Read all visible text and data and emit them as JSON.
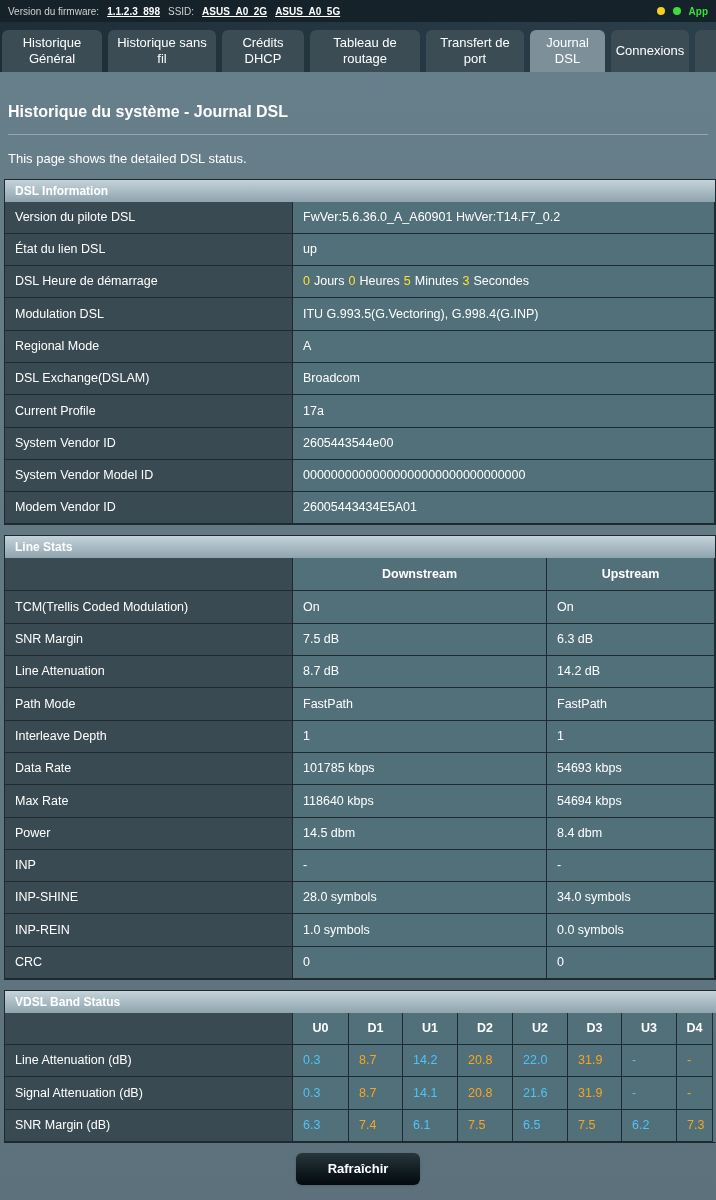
{
  "top_bar": {
    "firmware_label": "Version du firmware:",
    "firmware": "1.1.2.3_898",
    "ssid_label": "SSID:",
    "ssids": [
      "ASUS_A0_2G",
      "ASUS_A0_5G"
    ],
    "app": "App"
  },
  "tabs": [
    {
      "label": "Historique Général",
      "selected": false
    },
    {
      "label": "Historique sans fil",
      "selected": false
    },
    {
      "label": "Crédits DHCP",
      "selected": false
    },
    {
      "label": "Tableau de routage",
      "selected": false
    },
    {
      "label": "Transfert de port",
      "selected": false
    },
    {
      "label": "Journal DSL",
      "selected": true
    },
    {
      "label": "Connexions",
      "selected": false
    }
  ],
  "page_title": "Historique du système - Journal DSL",
  "description": "This page shows the detailed DSL status.",
  "dsl_information": {
    "title": "DSL Information",
    "rows": [
      {
        "label": "Version du pilote DSL",
        "value": "FwVer:5.6.36.0_A_A60901 HwVer:T14.F7_0.2"
      },
      {
        "label": "État du lien DSL",
        "value": "up"
      },
      {
        "label": "DSL Heure de démarrage",
        "parts": [
          {
            "kind": "number",
            "text": "0"
          },
          {
            "kind": "unit",
            "text": "Jours"
          },
          {
            "kind": "number",
            "text": "0"
          },
          {
            "kind": "unit",
            "text": "Heures"
          },
          {
            "kind": "number",
            "text": "5"
          },
          {
            "kind": "unit",
            "text": "Minutes"
          },
          {
            "kind": "number",
            "text": "3"
          },
          {
            "kind": "unit",
            "text": "Secondes"
          }
        ]
      },
      {
        "label": "Modulation DSL",
        "value": "ITU G.993.5(G.Vectoring), G.998.4(G.INP)"
      },
      {
        "label": "Regional Mode",
        "value": "A"
      },
      {
        "label": "DSL Exchange(DSLAM)",
        "value": "Broadcom"
      },
      {
        "label": "Current Profile",
        "value": "17a"
      },
      {
        "label": "System Vendor ID",
        "value": "2605443544e00"
      },
      {
        "label": "System Vendor Model ID",
        "value": "00000000000000000000000000000000"
      },
      {
        "label": "Modem Vendor ID",
        "value": "26005443434E5A01"
      }
    ]
  },
  "line_stats": {
    "title": "Line Stats",
    "columns": [
      "Downstream",
      "Upstream"
    ],
    "rows": [
      {
        "label": "TCM(Trellis Coded Modulation)",
        "values": [
          "On",
          "On"
        ]
      },
      {
        "label": "SNR Margin",
        "values": [
          "7.5 dB",
          "6.3 dB"
        ]
      },
      {
        "label": "Line Attenuation",
        "values": [
          "8.7 dB",
          "14.2 dB"
        ]
      },
      {
        "label": "Path Mode",
        "values": [
          "FastPath",
          "FastPath"
        ]
      },
      {
        "label": "Interleave Depth",
        "values": [
          "1",
          "1"
        ]
      },
      {
        "label": "Data Rate",
        "values": [
          "101785 kbps",
          "54693 kbps"
        ]
      },
      {
        "label": "Max Rate",
        "values": [
          "118640 kbps",
          "54694 kbps"
        ]
      },
      {
        "label": "Power",
        "values": [
          "14.5 dbm",
          "8.4 dbm"
        ]
      },
      {
        "label": "INP",
        "values": [
          "-",
          "-"
        ]
      },
      {
        "label": "INP-SHINE",
        "values": [
          "28.0 symbols",
          "34.0 symbols"
        ]
      },
      {
        "label": "INP-REIN",
        "values": [
          "1.0 symbols",
          "0.0 symbols"
        ]
      },
      {
        "label": "CRC",
        "values": [
          "0",
          "0"
        ]
      }
    ]
  },
  "vdsl_band_status": {
    "title": "VDSL Band Status",
    "columns": [
      {
        "label": "U0",
        "color": "#4fc3f7"
      },
      {
        "label": "D1",
        "color": "#f5a623"
      },
      {
        "label": "U1",
        "color": "#4fc3f7"
      },
      {
        "label": "D2",
        "color": "#f5a623"
      },
      {
        "label": "U2",
        "color": "#4fc3f7"
      },
      {
        "label": "D3",
        "color": "#f5a623"
      },
      {
        "label": "U3",
        "color": "#4fc3f7"
      },
      {
        "label": "D4",
        "color": "#f5a623"
      }
    ],
    "rows": [
      {
        "label": "Line Attenuation (dB)",
        "values": [
          "0.3",
          "8.7",
          "14.2",
          "20.8",
          "22.0",
          "31.9",
          "-",
          "-"
        ]
      },
      {
        "label": "Signal Attenuation (dB)",
        "values": [
          "0.3",
          "8.7",
          "14.1",
          "20.8",
          "21.6",
          "31.9",
          "-",
          "-"
        ]
      },
      {
        "label": "SNR Margin (dB)",
        "values": [
          "6.3",
          "7.4",
          "6.1",
          "7.5",
          "6.5",
          "7.5",
          "6.2",
          "7.3"
        ]
      }
    ]
  },
  "refresh_button": "Rafraîchir"
}
